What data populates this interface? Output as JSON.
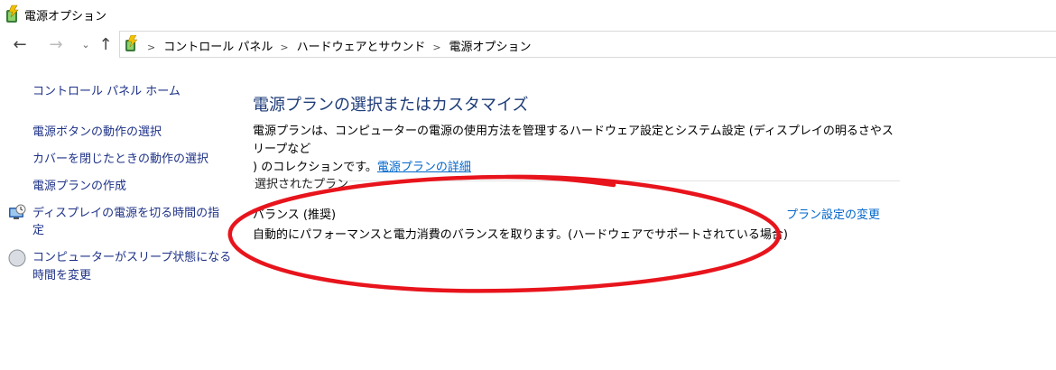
{
  "window": {
    "title": "電源オプション"
  },
  "nav": {
    "back": "←",
    "forward": "→",
    "recent": "⌄",
    "up": "↑"
  },
  "address": {
    "crumbs": [
      "コントロール パネル",
      "ハードウェアとサウンド",
      "電源オプション"
    ],
    "separator": ">"
  },
  "sidebar": {
    "home": "コントロール パネル ホーム",
    "links": [
      "電源ボタンの動作の選択",
      "カバーを閉じたときの動作の選択",
      "電源プランの作成"
    ],
    "display_line1": "ディスプレイの電源を切る時間の指",
    "display_line2": "定",
    "sleep_line1": "コンピューターがスリープ状態になる",
    "sleep_line2": "時間を変更"
  },
  "main": {
    "heading": "電源プランの選択またはカスタマイズ",
    "description_line1": "電源プランは、コンピューターの電源の使用方法を管理するハードウェア設定とシステム設定 (ディスプレイの明るさやスリープなど",
    "description_line2": ") のコレクションです。",
    "details_link": "電源プランの詳細",
    "section_label": "選択されたプラン",
    "plan_name": "バランス (推奨)",
    "plan_description": "自動的にパフォーマンスと電力消費のバランスを取ります。(ハードウェアでサポートされている場合)",
    "plan_change_link": "プラン設定の変更"
  },
  "annotation": {
    "color": "#e8141c"
  }
}
